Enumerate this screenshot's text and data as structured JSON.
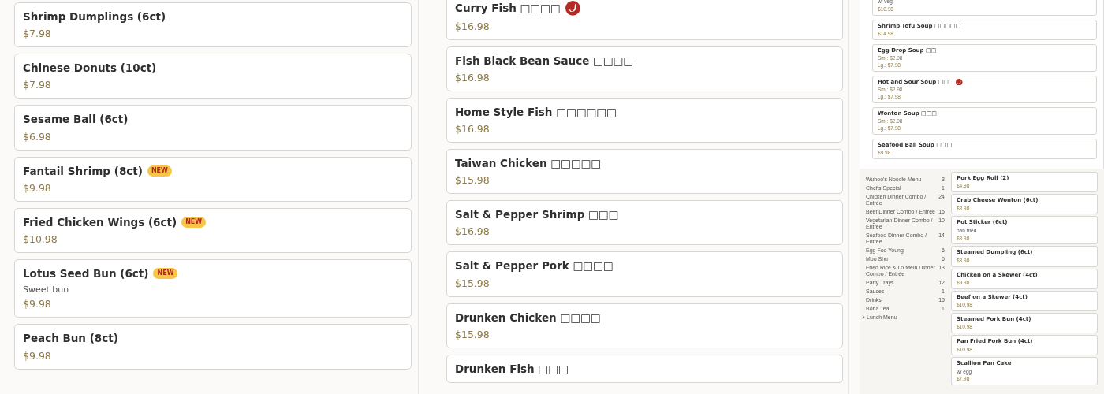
{
  "left_column": {
    "items": [
      {
        "name": "Shrimp Dumplings (6ct)",
        "prices": [
          "$7.98"
        ]
      },
      {
        "name": "Chinese Donuts (10ct)",
        "prices": [
          "$7.98"
        ]
      },
      {
        "name": "Sesame Ball (6ct)",
        "prices": [
          "$6.98"
        ]
      },
      {
        "name": "Fantail Shrimp (8ct)",
        "badge": {
          "kind": "new",
          "label": "NEW"
        },
        "prices": [
          "$9.98"
        ]
      },
      {
        "name": "Fried Chicken Wings (6ct)",
        "badge": {
          "kind": "new",
          "label": "NEW"
        },
        "prices": [
          "$10.98"
        ]
      },
      {
        "name": "Lotus Seed Bun (6ct)",
        "badge": {
          "kind": "new",
          "label": "NEW"
        },
        "description": "Sweet bun",
        "prices": [
          "$9.98"
        ]
      },
      {
        "name": "Peach Bun (8ct)",
        "prices": [
          "$9.98"
        ]
      }
    ]
  },
  "middle_column": {
    "items": [
      {
        "name": "Curry Fish",
        "chinese": "□□□□",
        "badge": {
          "kind": "spicy"
        },
        "prices": [
          "$16.98"
        ]
      },
      {
        "name": "Fish Black Bean Sauce",
        "chinese": "□□□□",
        "prices": [
          "$16.98"
        ]
      },
      {
        "name": "Home Style Fish",
        "chinese": "□□□□□□",
        "prices": [
          "$16.98"
        ]
      },
      {
        "name": "Taiwan Chicken",
        "chinese": "□□□□□",
        "prices": [
          "$15.98"
        ]
      },
      {
        "name": "Salt & Pepper Shrimp",
        "chinese": "□□□",
        "prices": [
          "$16.98"
        ]
      },
      {
        "name": "Salt & Pepper Pork",
        "chinese": "□□□□",
        "prices": [
          "$15.98"
        ]
      },
      {
        "name": "Drunken Chicken",
        "chinese": "□□□□",
        "prices": [
          "$15.98"
        ]
      },
      {
        "name": "Drunken Fish",
        "chinese": "□□□"
      }
    ]
  },
  "soup_panel": {
    "items": [
      {
        "description": "w/ veg.",
        "prices": [
          "$10.98"
        ]
      },
      {
        "name": "Shrimp Tofu Soup",
        "chinese": "□□□□□",
        "prices": [
          "$14.98"
        ]
      },
      {
        "name": "Egg Drop Soup",
        "chinese": "□□",
        "prices": [
          "Sm.: $2.98",
          "Lg.: $7.98"
        ]
      },
      {
        "name": "Hot and Sour Soup",
        "chinese": "□□□",
        "badge": {
          "kind": "spicy"
        },
        "prices": [
          "Sm.: $2.98",
          "Lg.: $7.98"
        ]
      },
      {
        "name": "Wonton Soup",
        "chinese": "□□□",
        "prices": [
          "Sm.: $2.98",
          "Lg.: $7.98"
        ]
      },
      {
        "name": "Seafood Ball Soup",
        "chinese": "□□□",
        "prices": [
          "$9.98"
        ]
      }
    ]
  },
  "sidebar": {
    "items": [
      {
        "kind": "category",
        "label": "Wuhoo's Noodle Menu",
        "count": "3"
      },
      {
        "kind": "category",
        "label": "Chef's Special",
        "count": "1"
      },
      {
        "kind": "category",
        "label": "Chicken Dinner Combo / Entrée",
        "count": "24"
      },
      {
        "kind": "category",
        "label": "Beef Dinner Combo / Entrée",
        "count": "15"
      },
      {
        "kind": "category",
        "label": "Vegetarian Dinner Combo / Entrée",
        "count": "10"
      },
      {
        "kind": "category",
        "label": "Seafood Dinner Combo / Entrée",
        "count": "14"
      },
      {
        "kind": "category",
        "label": "Egg Foo Young",
        "count": "6"
      },
      {
        "kind": "category",
        "label": "Moo Shu",
        "count": "6"
      },
      {
        "kind": "category",
        "label": "Fried Rice & Lo Mein Dinner Combo / Entrée",
        "count": "13"
      },
      {
        "kind": "category",
        "label": "Party Trays",
        "count": "12"
      },
      {
        "kind": "category",
        "label": "Sauces",
        "count": "1"
      },
      {
        "kind": "category",
        "label": "Drinks",
        "count": "15"
      },
      {
        "kind": "category",
        "label": "Boba Tea",
        "count": "1"
      },
      {
        "kind": "group",
        "label": "Lunch Menu"
      }
    ]
  },
  "lunch_list": {
    "items": [
      {
        "name": "Pork Egg Roll (2)",
        "prices": [
          "$4.98"
        ]
      },
      {
        "name": "Crab Cheese Wonton (6ct)",
        "prices": [
          "$8.98"
        ]
      },
      {
        "name": "Pot Sticker (6ct)",
        "description": "pan fried",
        "prices": [
          "$8.98"
        ]
      },
      {
        "name": "Steamed Dumpling (6ct)",
        "prices": [
          "$8.98"
        ]
      },
      {
        "name": "Chicken on a Skewer (4ct)",
        "prices": [
          "$9.98"
        ]
      },
      {
        "name": "Beef on a Skewer (4ct)",
        "prices": [
          "$10.98"
        ]
      },
      {
        "name": "Steamed Pork Bun (4ct)",
        "prices": [
          "$10.98"
        ]
      },
      {
        "name": "Pan Fried Pork Bun (4ct)",
        "prices": [
          "$10.98"
        ]
      },
      {
        "name": "Scallion Pan Cake",
        "description": "w/ egg",
        "prices": [
          "$7.98"
        ]
      }
    ]
  }
}
